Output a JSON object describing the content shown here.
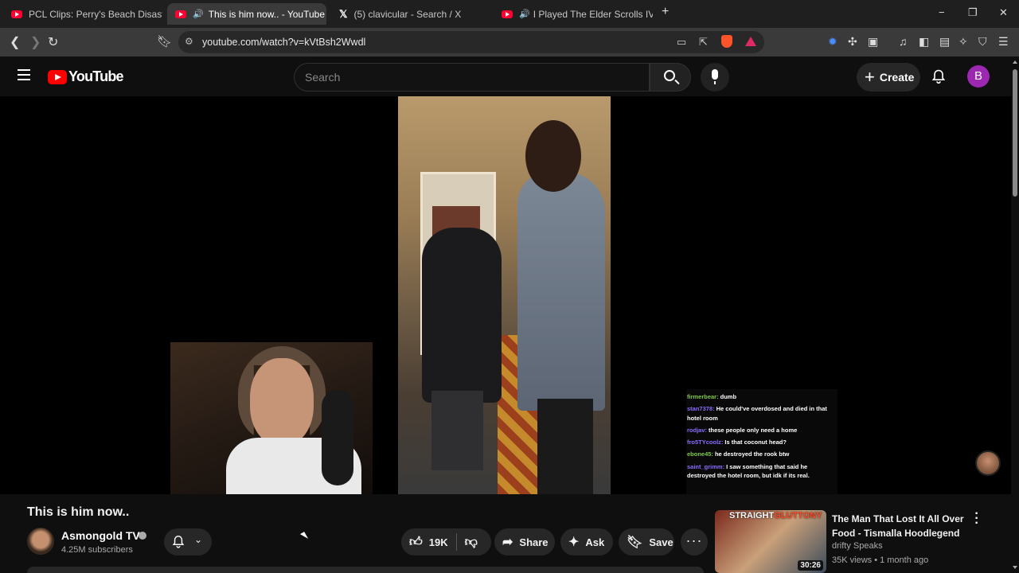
{
  "browser": {
    "tabs": [
      {
        "label": "PCL Clips: Perry's Beach Disaster - Yo",
        "type": "youtube"
      },
      {
        "label": "This is him now.. - YouTube",
        "type": "youtube",
        "active": true,
        "audio": true
      },
      {
        "label": "(5) clavicular - Search / X",
        "type": "x"
      },
      {
        "label": "I Played The Elder Scrolls IV: Obli",
        "type": "youtube",
        "audio": true
      }
    ],
    "url": "youtube.com/watch?v=kVtBsh2Wwdl",
    "window_controls": [
      "−",
      "❐",
      "✕"
    ]
  },
  "youtube": {
    "logo_text": "YouTube",
    "search_placeholder": "Search",
    "create_label": "Create",
    "avatar_letter": "B"
  },
  "chat": [
    {
      "user": "firmerbear:",
      "text": "dumb",
      "color": "#7ec850"
    },
    {
      "user": "stan7378:",
      "text": "He could've overdosed and died in that hotel room",
      "color": "#8a6cff"
    },
    {
      "user": "rodjav:",
      "text": "these people only need a home",
      "color": "#8a6cff"
    },
    {
      "user": "fro5TYcoolz:",
      "text": "Is that coconut head?",
      "color": "#8a6cff"
    },
    {
      "user": "ebone45:",
      "text": "he destroyed the rook btw",
      "color": "#7ec850"
    },
    {
      "user": "saint_grimm:",
      "text": "I saw something that said he destroyed the hotel room, but idk if its real.",
      "color": "#8a6cff"
    }
  ],
  "video": {
    "title": "This is him now..",
    "channel": "Asmongold TV",
    "subscribers": "4.25M subscribers",
    "likes": "19K",
    "share_label": "Share",
    "ask_label": "Ask",
    "save_label": "Save",
    "more_label": "···"
  },
  "recommended": {
    "thumb_text_white": "STRAIGHT",
    "thumb_text_red": "GLUTTONY",
    "duration": "30:26",
    "title": "The Man That Lost It All Over Food - Tismalla  Hoodlegend",
    "channel": "drifty Speaks",
    "meta": "35K views • 1 month ago"
  }
}
